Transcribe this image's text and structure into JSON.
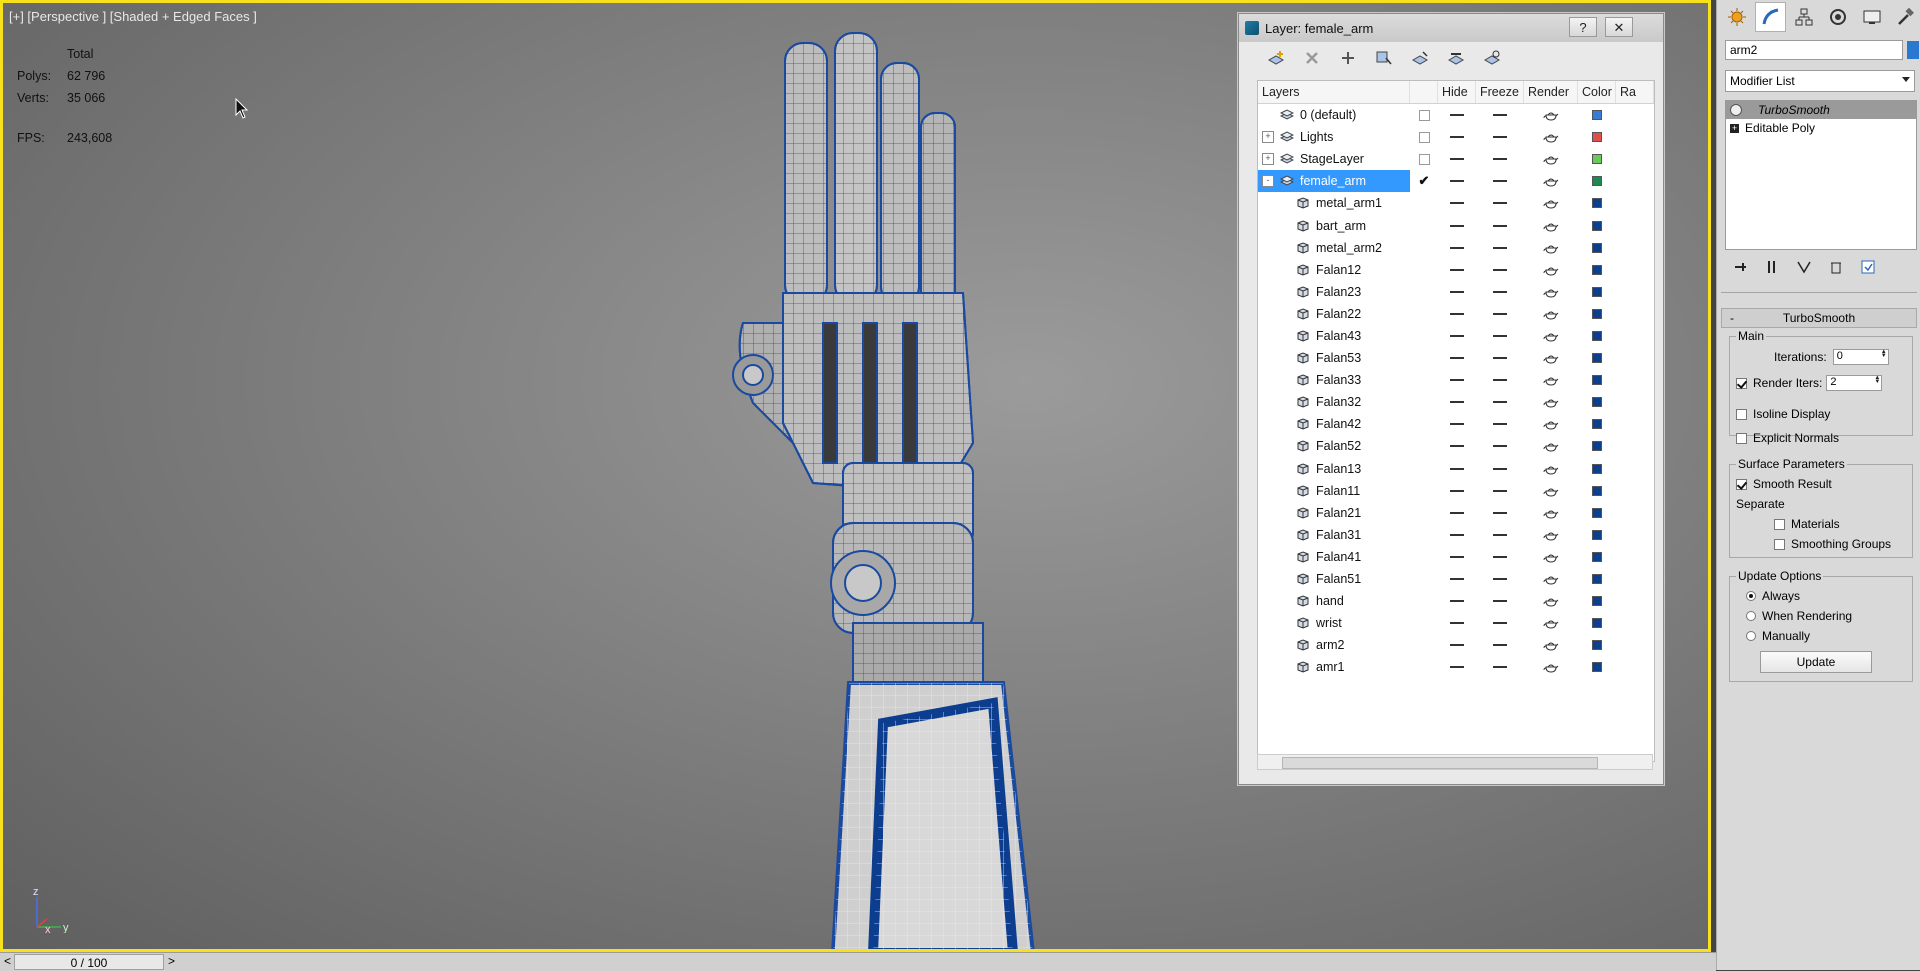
{
  "viewport": {
    "label": "[+] [Perspective ] [Shaded + Edged Faces ]",
    "stats": {
      "total_label": "Total",
      "polys_label": "Polys:",
      "polys_value": "62 796",
      "verts_label": "Verts:",
      "verts_value": "35 066",
      "fps_label": "FPS:",
      "fps_value": "243,608"
    },
    "axis": {
      "z": "z",
      "x": "x",
      "y": "y"
    }
  },
  "layer_dialog": {
    "title": "Layer: female_arm",
    "help_label": "?",
    "close_label": "✕",
    "columns": {
      "layers": "Layers",
      "hide": "Hide",
      "freeze": "Freeze",
      "render": "Render",
      "color": "Color",
      "radiosity": "Ra"
    },
    "rows": [
      {
        "name": "0 (default)",
        "type": "layer",
        "expand": "",
        "color": "#3a7bd5"
      },
      {
        "name": "Lights",
        "type": "layer",
        "expand": "+",
        "color": "#e0504a"
      },
      {
        "name": "StageLayer",
        "type": "layer",
        "expand": "+",
        "color": "#6ac95b"
      },
      {
        "name": "female_arm",
        "type": "layer",
        "expand": "-",
        "color": "#1e8a4f",
        "selected": true,
        "current": "✔"
      },
      {
        "name": "metal_arm1",
        "type": "object",
        "color": "#0c3f8e"
      },
      {
        "name": "bart_arm",
        "type": "object",
        "color": "#0c3f8e"
      },
      {
        "name": "metal_arm2",
        "type": "object",
        "color": "#0c3f8e"
      },
      {
        "name": "Falan12",
        "type": "object",
        "color": "#0c3f8e"
      },
      {
        "name": "Falan23",
        "type": "object",
        "color": "#0c3f8e"
      },
      {
        "name": "Falan22",
        "type": "object",
        "color": "#0c3f8e"
      },
      {
        "name": "Falan43",
        "type": "object",
        "color": "#0c3f8e"
      },
      {
        "name": "Falan53",
        "type": "object",
        "color": "#0c3f8e"
      },
      {
        "name": "Falan33",
        "type": "object",
        "color": "#0c3f8e"
      },
      {
        "name": "Falan32",
        "type": "object",
        "color": "#0c3f8e"
      },
      {
        "name": "Falan42",
        "type": "object",
        "color": "#0c3f8e"
      },
      {
        "name": "Falan52",
        "type": "object",
        "color": "#0c3f8e"
      },
      {
        "name": "Falan13",
        "type": "object",
        "color": "#0c3f8e"
      },
      {
        "name": "Falan11",
        "type": "object",
        "color": "#0c3f8e"
      },
      {
        "name": "Falan21",
        "type": "object",
        "color": "#0c3f8e"
      },
      {
        "name": "Falan31",
        "type": "object",
        "color": "#0c3f8e"
      },
      {
        "name": "Falan41",
        "type": "object",
        "color": "#0c3f8e"
      },
      {
        "name": "Falan51",
        "type": "object",
        "color": "#0c3f8e"
      },
      {
        "name": "hand",
        "type": "object",
        "color": "#0c3f8e"
      },
      {
        "name": "wrist",
        "type": "object",
        "color": "#0c3f8e"
      },
      {
        "name": "arm2",
        "type": "object",
        "color": "#0c3f8e"
      },
      {
        "name": "amr1",
        "type": "object",
        "color": "#0c3f8e"
      }
    ]
  },
  "command_panel": {
    "object_name": "arm2",
    "object_color": "#2b78d1",
    "modifier_list": "Modifier List",
    "stack": [
      {
        "label": "TurboSmooth",
        "selected": true
      },
      {
        "label": "Editable Poly",
        "selected": false
      }
    ],
    "rollout": {
      "title": "TurboSmooth",
      "collapse_label": "-",
      "main_group": "Main",
      "iterations_label": "Iterations:",
      "iterations_value": "0",
      "render_iters_label": "Render Iters:",
      "render_iters_value": "2",
      "isoline_label": "Isoline Display",
      "explicit_normals_label": "Explicit Normals",
      "surface_group": "Surface Parameters",
      "smooth_result_label": "Smooth Result",
      "separate_label": "Separate",
      "materials_label": "Materials",
      "smoothing_groups_label": "Smoothing Groups",
      "update_group": "Update Options",
      "always_label": "Always",
      "when_rendering_label": "When Rendering",
      "manually_label": "Manually",
      "update_button": "Update"
    }
  },
  "timeline": {
    "frame": "0 / 100",
    "prev": "<",
    "next": ">"
  }
}
